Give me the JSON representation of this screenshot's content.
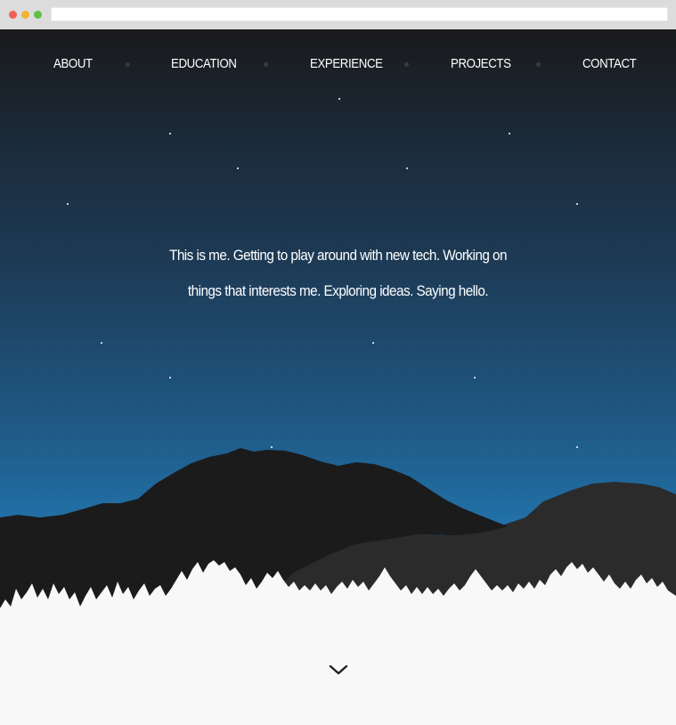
{
  "nav": {
    "items": [
      {
        "label": "ABOUT"
      },
      {
        "label": "EDUCATION"
      },
      {
        "label": "EXPERIENCE"
      },
      {
        "label": "PROJECTS"
      },
      {
        "label": "CONTACT"
      }
    ]
  },
  "hero": {
    "line1": "This is me. Getting to play around with new tech. Working on",
    "line2": "things that interests me. Exploring ideas. Saying hello."
  },
  "scroll": {
    "icon": "chevron-down-icon"
  },
  "colors": {
    "sky_top": "#1a1a1b",
    "sky_bottom": "#2274ad",
    "mountain_front": "#1b1b1c",
    "mountain_back": "#2b2b2c",
    "trees": "#f8f8f8"
  }
}
